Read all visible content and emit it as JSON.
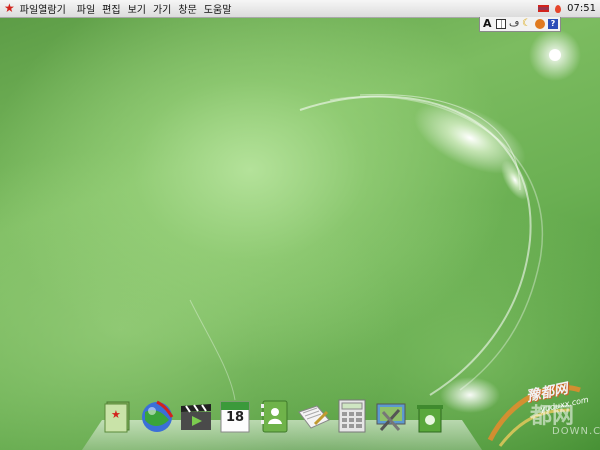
{
  "menubar": {
    "items": [
      "파일열람기",
      "파일",
      "편집",
      "보기",
      "가기",
      "창문",
      "도움말"
    ],
    "clock": "07:51"
  },
  "ime_toolbar": {
    "letter": "A",
    "help": "?"
  },
  "dock": {
    "items": [
      {
        "name": "photo-viewer"
      },
      {
        "name": "web-browser"
      },
      {
        "name": "video-player"
      },
      {
        "name": "calendar",
        "day": "18"
      },
      {
        "name": "address-book"
      },
      {
        "name": "text-editor"
      },
      {
        "name": "calculator"
      },
      {
        "name": "system-settings"
      },
      {
        "name": "trash"
      }
    ]
  },
  "watermark": {
    "cn": "豫都网",
    "url": "yuduxx.com",
    "big": "都网",
    "down": "DOWN.COM"
  },
  "colors": {
    "accent_red": "#d2231c",
    "wallpaper_green": "#6aaf52"
  }
}
